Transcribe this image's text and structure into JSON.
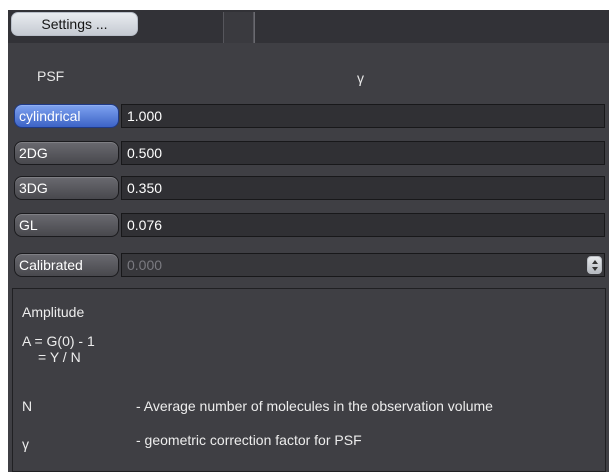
{
  "toolbar": {
    "settings_label": "Settings ..."
  },
  "columns": {
    "psf": "PSF",
    "gamma": "γ"
  },
  "rows": [
    {
      "psf": "cylindrical",
      "gamma": "1.000",
      "selected": true,
      "enabled": true
    },
    {
      "psf": "2DG",
      "gamma": "0.500",
      "selected": false,
      "enabled": true
    },
    {
      "psf": "3DG",
      "gamma": "0.350",
      "selected": false,
      "enabled": true
    },
    {
      "psf": "GL",
      "gamma": "0.076",
      "selected": false,
      "enabled": true
    },
    {
      "psf": "Calibrated",
      "gamma": "0.000",
      "selected": false,
      "enabled": false
    }
  ],
  "info": {
    "title": "Amplitude",
    "formula_line1": "A = G(0) - 1",
    "formula_line2": "= Y / N",
    "defs": [
      {
        "symbol": "N",
        "text": "- Average number of molecules in the observation volume"
      },
      {
        "symbol": "γ",
        "text": "- geometric correction factor for PSF"
      }
    ]
  },
  "colors": {
    "panel_bg": "#3f3f44",
    "accent_blue": "#4a72d6",
    "field_bg": "#303034"
  },
  "icons": {
    "spinner": "stepper-arrows-icon"
  }
}
